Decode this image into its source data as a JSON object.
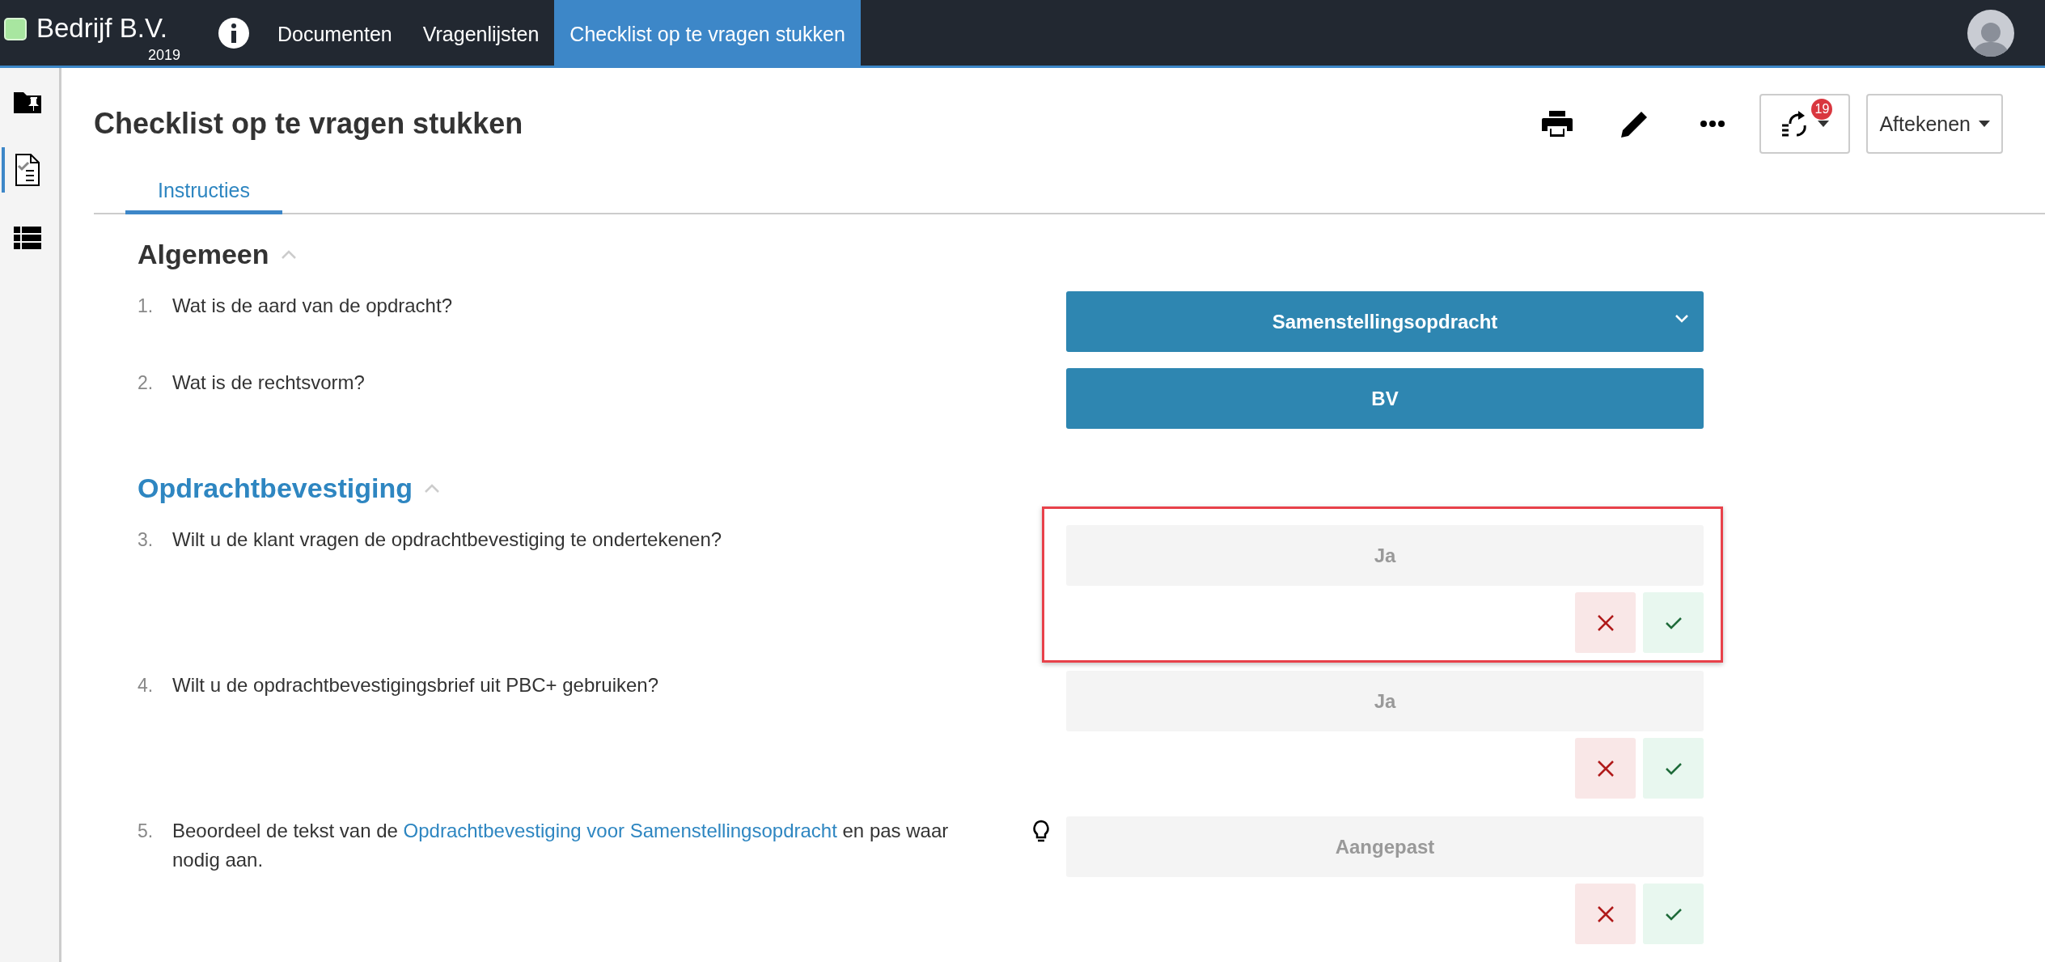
{
  "topbar": {
    "company": "Bedrijf B.V.",
    "year": "2019",
    "nav": [
      {
        "label": "Documenten",
        "selected": false
      },
      {
        "label": "Vragenlijsten",
        "selected": false
      },
      {
        "label": "Checklist op te vragen stukken",
        "selected": true
      }
    ]
  },
  "sidebar": {
    "items": [
      {
        "kind": "folder-pin",
        "selected": false
      },
      {
        "kind": "checklist",
        "selected": true
      },
      {
        "kind": "list",
        "selected": false
      }
    ]
  },
  "page": {
    "title": "Checklist op te vragen stukken",
    "toolbar": [
      {
        "kind": "print"
      },
      {
        "kind": "edit"
      },
      {
        "kind": "more"
      }
    ],
    "workflow_badge": "19",
    "sign_button": "Aftekenen"
  },
  "tabs": [
    {
      "label": "Instructies",
      "selected": true
    }
  ],
  "sections": [
    {
      "title": "Algemeen",
      "expanded": true,
      "active": false,
      "questions": [
        {
          "number": "1.",
          "text": "Wat is de aard van de opdracht?",
          "kind": "dropdown",
          "answer": "Samenstellingsopdracht",
          "hint": false,
          "highlighted": false
        },
        {
          "number": "2.",
          "text": "Wat is de rechtsvorm?",
          "kind": "value",
          "answer": "BV",
          "hint": false,
          "highlighted": false
        }
      ]
    },
    {
      "title": "Opdrachtbevestiging",
      "expanded": true,
      "active": true,
      "questions": [
        {
          "number": "3.",
          "text": "Wilt u de klant vragen de opdrachtbevestiging te ondertekenen?",
          "kind": "review",
          "answer": "Ja",
          "hint": false,
          "highlighted": true
        },
        {
          "number": "4.",
          "text": "Wilt u de opdrachtbevestigingsbrief uit PBC+  gebruiken?",
          "kind": "review",
          "answer": "Ja",
          "hint": false,
          "highlighted": false
        },
        {
          "number": "5.",
          "text": "Beoordeel de tekst van de ",
          "link": "Opdrachtbevestiging voor Samenstellingsopdracht",
          "text_after": " en pas waar nodig aan.",
          "kind": "review",
          "answer": "Aangepast",
          "hint": true,
          "highlighted": false
        }
      ]
    }
  ]
}
